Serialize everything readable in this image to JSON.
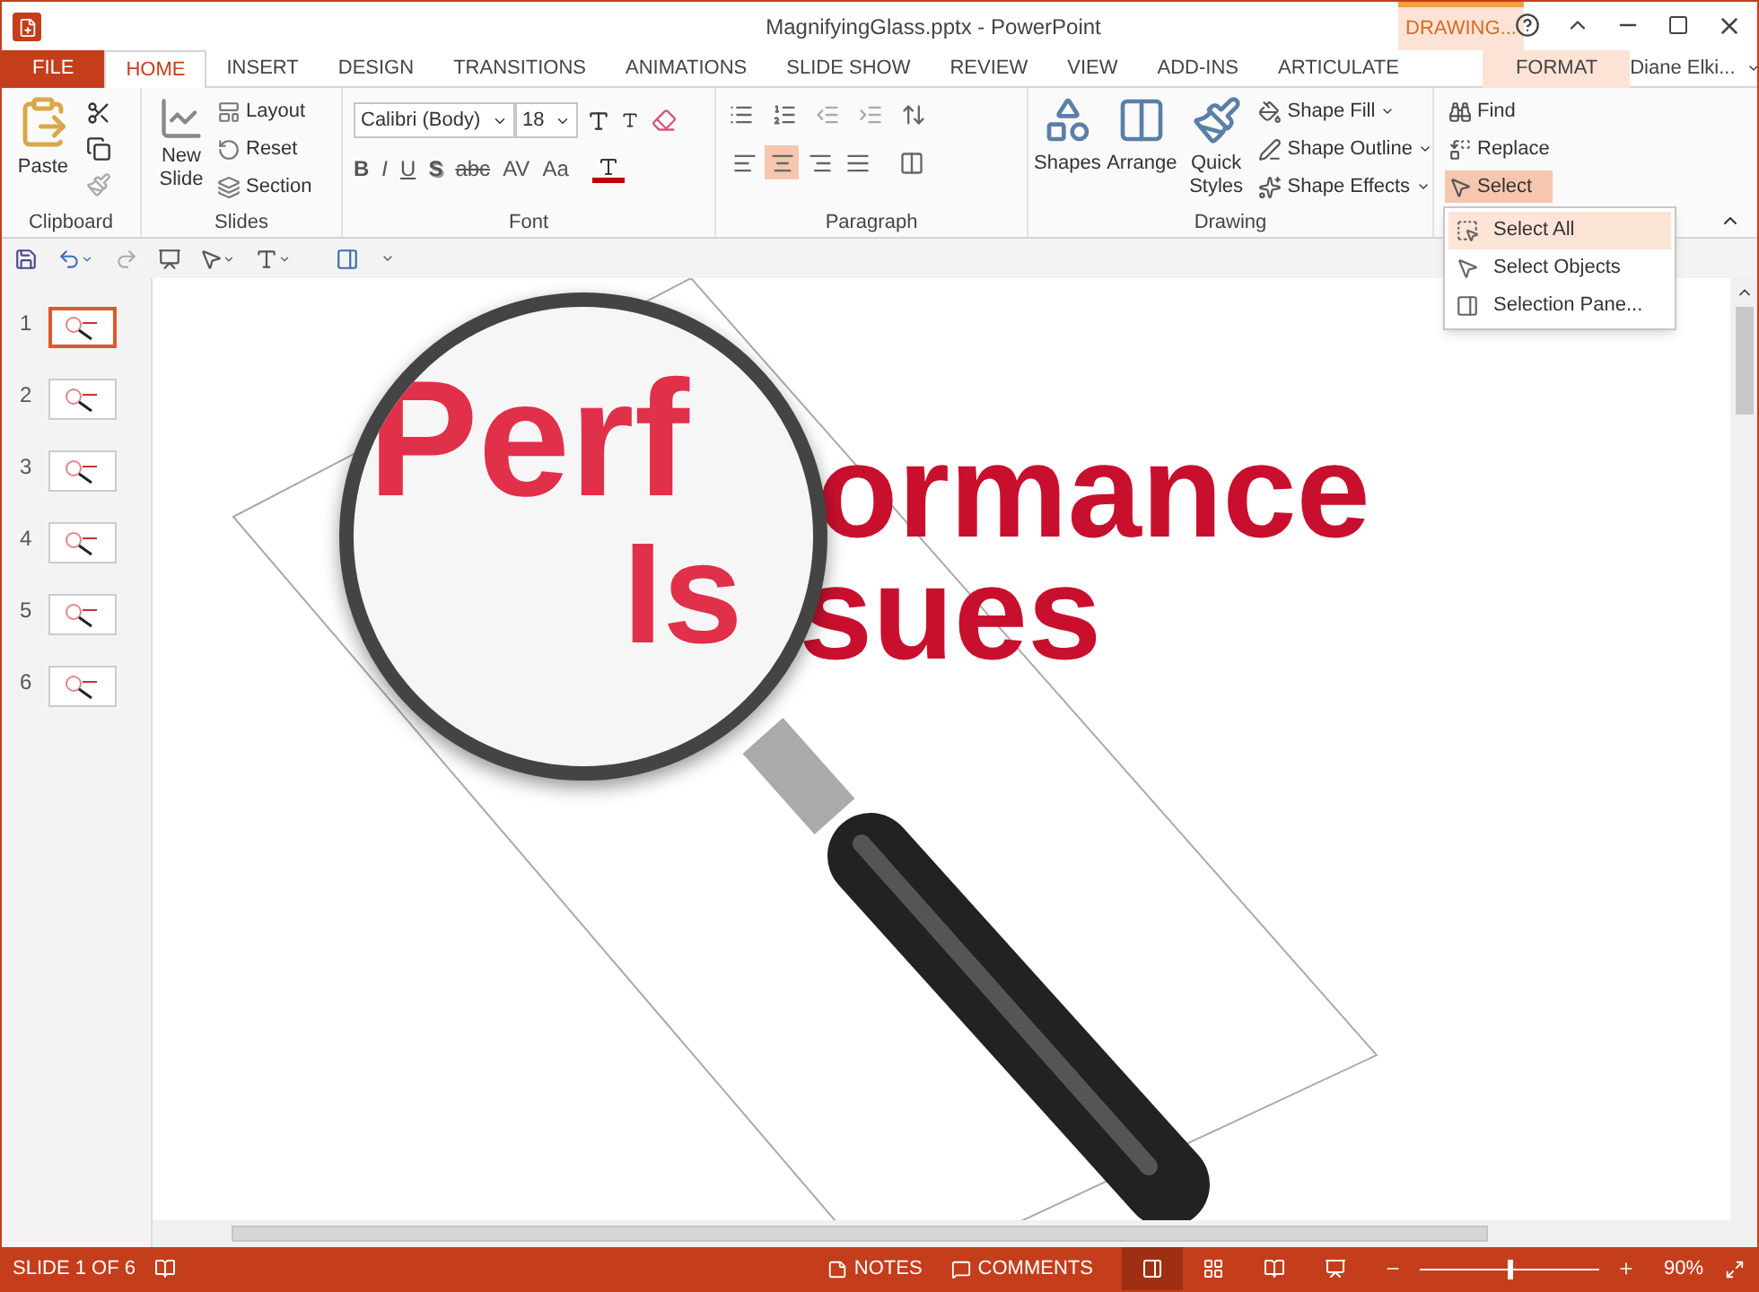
{
  "window": {
    "title": "MagnifyingGlass.pptx - PowerPoint",
    "contextual_label": "DRAWING..."
  },
  "tabs": [
    {
      "label": "FILE",
      "kind": "file",
      "selected": false
    },
    {
      "label": "HOME",
      "kind": "normal",
      "selected": true
    },
    {
      "label": "INSERT",
      "kind": "normal",
      "selected": false
    },
    {
      "label": "DESIGN",
      "kind": "normal",
      "selected": false
    },
    {
      "label": "TRANSITIONS",
      "kind": "normal",
      "selected": false
    },
    {
      "label": "ANIMATIONS",
      "kind": "normal",
      "selected": false
    },
    {
      "label": "SLIDE SHOW",
      "kind": "normal",
      "selected": false
    },
    {
      "label": "REVIEW",
      "kind": "normal",
      "selected": false
    },
    {
      "label": "VIEW",
      "kind": "normal",
      "selected": false
    },
    {
      "label": "ADD-INS",
      "kind": "normal",
      "selected": false
    },
    {
      "label": "ARTICULATE",
      "kind": "normal",
      "selected": false
    },
    {
      "label": "FORMAT",
      "kind": "contextual",
      "selected": false
    }
  ],
  "user": {
    "name": "Diane Elki..."
  },
  "ribbon": {
    "clipboard": {
      "label": "Clipboard",
      "paste": "Paste"
    },
    "slides": {
      "label": "Slides",
      "new_slide": "New Slide",
      "items": [
        "Layout",
        "Reset",
        "Section"
      ]
    },
    "font": {
      "label": "Font",
      "name": "Calibri (Body)",
      "size": "18",
      "format_buttons": [
        {
          "text": "B",
          "kind": "bold"
        },
        {
          "text": "I",
          "kind": "italic"
        },
        {
          "text": "U",
          "kind": "underline"
        },
        {
          "text": "S",
          "kind": "shadow"
        },
        {
          "text": "abc",
          "kind": "strike"
        },
        {
          "text": "AV",
          "kind": "spacing"
        },
        {
          "text": "Aa",
          "kind": "case"
        }
      ]
    },
    "paragraph": {
      "label": "Paragraph",
      "align_buttons": [
        {
          "selected": false
        },
        {
          "selected": true
        },
        {
          "selected": false
        },
        {
          "selected": false
        }
      ]
    },
    "drawing": {
      "label": "Drawing",
      "large": [
        "Shapes",
        "Arrange",
        "Quick Styles"
      ],
      "items": [
        "Shape Fill",
        "Shape Outline",
        "Shape Effects"
      ]
    },
    "editing": {
      "items": [
        "Find",
        "Replace",
        "Select"
      ],
      "select_open": true
    }
  },
  "select_menu": {
    "items": [
      {
        "label": "Select All",
        "selected": true
      },
      {
        "label": "Select Objects",
        "selected": false
      },
      {
        "label": "Selection Pane...",
        "selected": false
      }
    ]
  },
  "thumbnails": [
    {
      "number": "1",
      "selected": true
    },
    {
      "number": "2",
      "selected": false
    },
    {
      "number": "3",
      "selected": false
    },
    {
      "number": "4",
      "selected": false
    },
    {
      "number": "5",
      "selected": false
    },
    {
      "number": "6",
      "selected": false
    }
  ],
  "slide": {
    "lines": [
      {
        "magnified": "Perf",
        "rest": "ormance"
      },
      {
        "magnified": "Is",
        "rest": "sues"
      }
    ]
  },
  "status_bar": {
    "slide_info": "SLIDE 1 OF 6",
    "notes": "NOTES",
    "comments": "COMMENTS",
    "views": [
      {
        "selected": true
      },
      {
        "selected": false
      },
      {
        "selected": false
      },
      {
        "selected": false
      }
    ],
    "zoom": {
      "level": 0.5,
      "reading": "90%"
    }
  }
}
